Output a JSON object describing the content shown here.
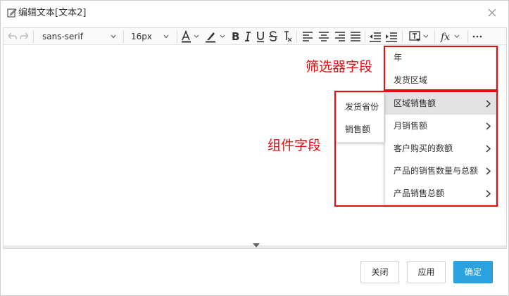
{
  "dialog": {
    "title": "编辑文本[文本2]"
  },
  "toolbar": {
    "font_family": "sans-serif",
    "font_size": "16px"
  },
  "annotations": {
    "filter_fields": "筛选器字段",
    "component_fields": "组件字段"
  },
  "filter_menu": {
    "items": [
      "年",
      "发货区域"
    ]
  },
  "component_menu": {
    "items": [
      "区域销售额",
      "月销售额",
      "客户购买的数额",
      "产品的销售数量与总额",
      "产品销售总额"
    ]
  },
  "submenu": {
    "items": [
      "发货省份",
      "销售额"
    ]
  },
  "footer": {
    "close_label": "关闭",
    "apply_label": "应用",
    "confirm_label": "确定"
  },
  "colors": {
    "annotation_red": "#e01010",
    "primary_blue": "#2aa2e0",
    "active_item_bg": "#e3e3e3"
  }
}
